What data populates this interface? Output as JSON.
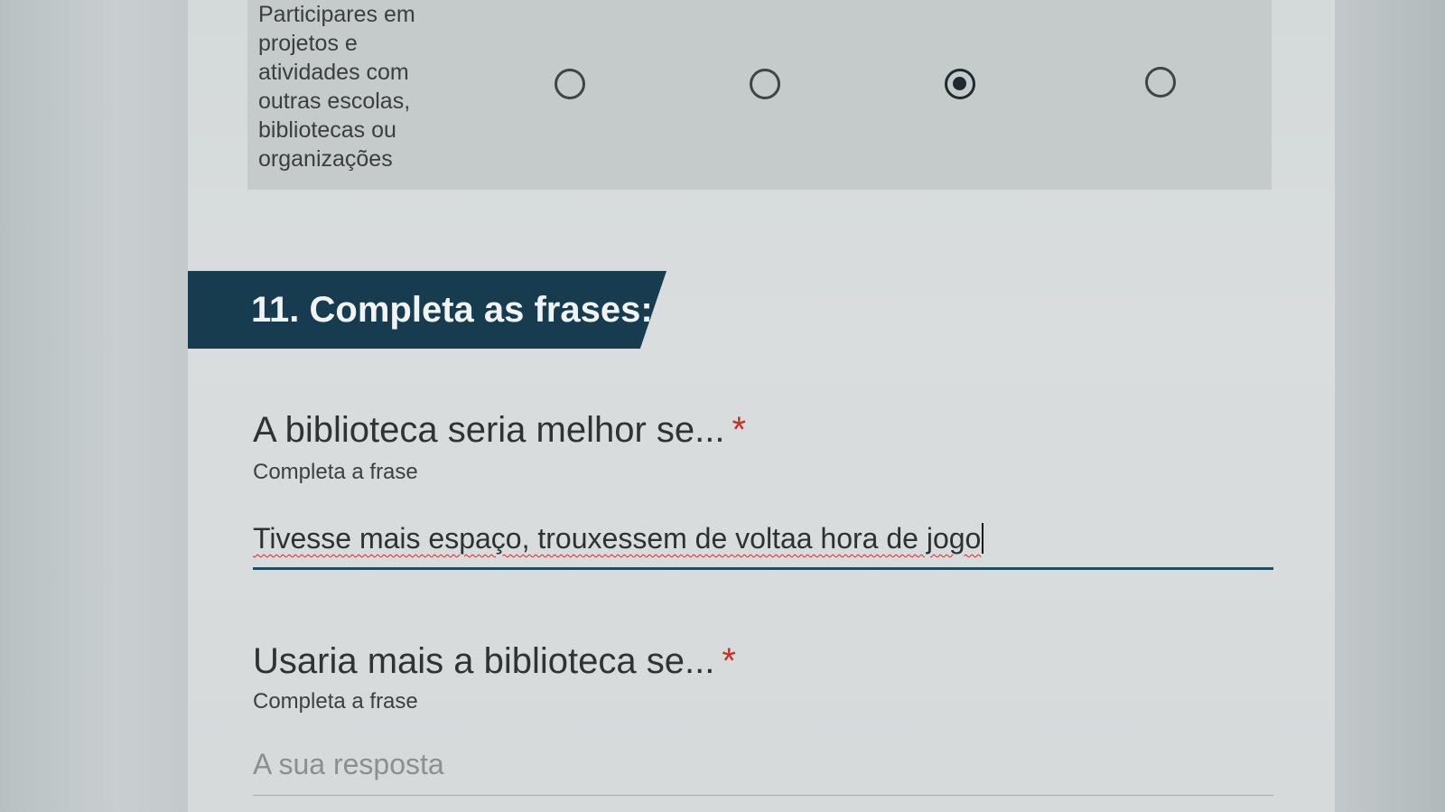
{
  "grid": {
    "row_label": "Participares em projetos e atividades com outras escolas, bibliotecas ou organizações",
    "options": [
      {
        "selected": false
      },
      {
        "selected": false
      },
      {
        "selected": true
      },
      {
        "selected": false
      }
    ]
  },
  "section": {
    "title": "11. Completa as frases:"
  },
  "questions": [
    {
      "title": "A biblioteca seria melhor se...",
      "required_mark": "*",
      "help": "Completa a frase",
      "value": "Tivesse mais espaço, trouxessem de voltaa hora de jogo"
    },
    {
      "title": "Usaria mais a biblioteca se...",
      "required_mark": "*",
      "help": "Completa a frase",
      "placeholder": "A sua resposta"
    }
  ],
  "colors": {
    "section_header_bg": "#173c4f",
    "required": "#c2322a",
    "input_focus_line": "#1d4f63"
  }
}
